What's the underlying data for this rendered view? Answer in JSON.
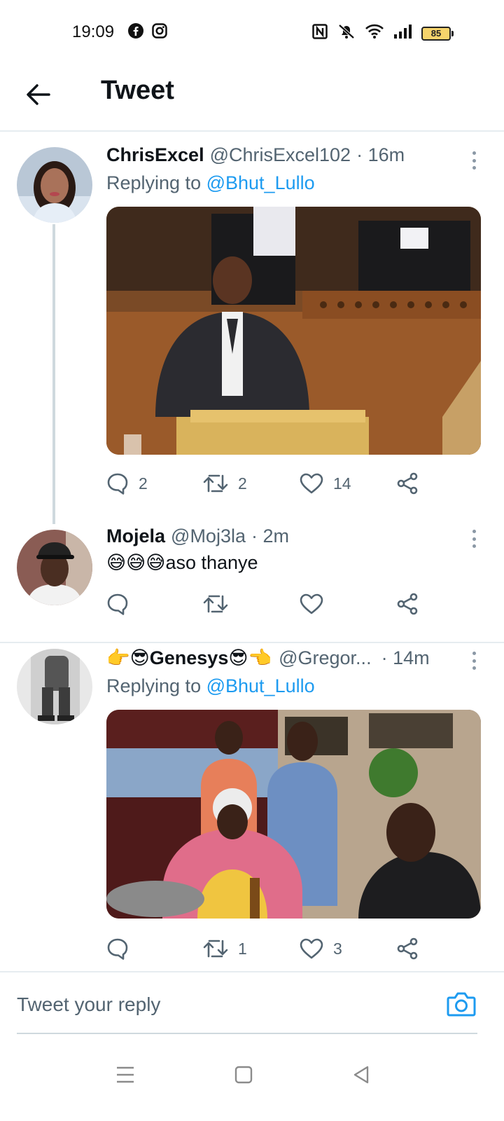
{
  "status_bar": {
    "time": "19:09",
    "battery": "85",
    "left_icons": [
      "facebook-icon",
      "instagram-icon"
    ],
    "right_icons": [
      "nfc-icon",
      "mute-icon",
      "wifi-icon",
      "signal-icon",
      "battery-icon"
    ]
  },
  "header": {
    "title": "Tweet",
    "back_icon": "arrow-left-icon"
  },
  "tweets": [
    {
      "name": "ChrisExcel",
      "handle": "@ChrisExcel102",
      "time": "· 16m",
      "reply_prefix": "Replying to",
      "reply_to": "@Bhut_Lullo",
      "reply_count": "2",
      "retweet_count": "2",
      "like_count": "14"
    },
    {
      "name": "Mojela",
      "handle": "@Moj3la",
      "time": "· 2m",
      "emoji": "😅😅😅",
      "text": "aso thanye",
      "reply_count": "",
      "retweet_count": "",
      "like_count": ""
    },
    {
      "name_prefix_emoji": "👉😎",
      "name": "Genesys",
      "name_suffix_emoji": "😎👈",
      "handle": "@Gregor...",
      "time": "· 14m",
      "reply_prefix": "Replying to",
      "reply_to": "@Bhut_Lullo",
      "reply_count": "",
      "retweet_count": "1",
      "like_count": "3"
    }
  ],
  "composer": {
    "placeholder": "Tweet your reply",
    "camera_icon": "camera-icon"
  },
  "colors": {
    "accent": "#1d9bf0",
    "text": "#0f1419",
    "secondary": "#536471",
    "divider": "#e6ecf0"
  }
}
